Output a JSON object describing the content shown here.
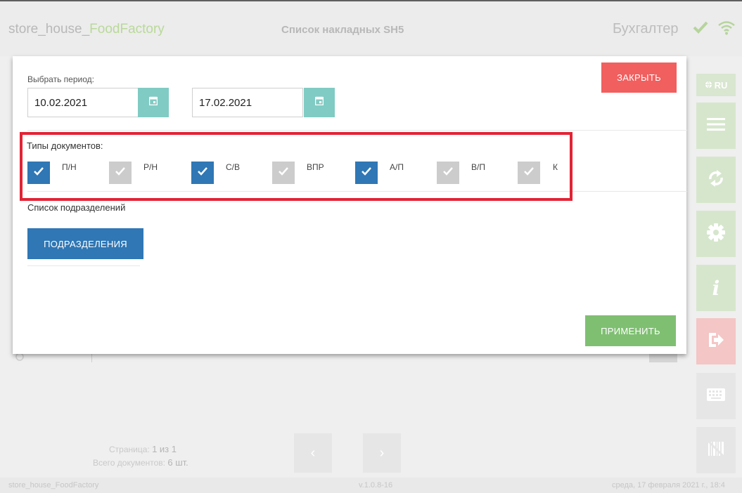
{
  "header": {
    "app_name_prefix": "store_house_",
    "app_name_accent": "FoodFactory",
    "page_title": "Список накладных SH5",
    "user_role": "Бухгалтер"
  },
  "sidebar": {
    "lang_label": "RU",
    "icons": [
      "globe-icon",
      "menu-icon",
      "sync-icon",
      "gear-icon",
      "info-icon",
      "exit-icon",
      "keyboard-icon",
      "barcode-icon"
    ],
    "info_glyph": "i"
  },
  "modal": {
    "period_label": "Выбрать период:",
    "date_from": "10.02.2021",
    "date_to": "17.02.2021",
    "close_label": "ЗАКРЫТЬ",
    "doc_types_label": "Типы документов:",
    "doc_types": [
      {
        "label": "П/Н",
        "checked": true
      },
      {
        "label": "Р/Н",
        "checked": false
      },
      {
        "label": "С/В",
        "checked": true
      },
      {
        "label": "ВПР",
        "checked": false
      },
      {
        "label": "А/П",
        "checked": true
      },
      {
        "label": "В/П",
        "checked": false
      },
      {
        "label": "К",
        "checked": false
      }
    ],
    "units_label": "Список подразделений",
    "units_button": "ПОДРАЗДЕЛЕНИЯ",
    "apply_label": "ПРИМЕНИТЬ"
  },
  "pager": {
    "page_prefix": "Страница:",
    "page_value": "1 из 1",
    "docs_prefix": "Всего документов:",
    "docs_value": "6 шт.",
    "prev_glyph": "‹",
    "next_glyph": "›"
  },
  "footer": {
    "left": "store_house_FoodFactory",
    "version": "v.1.0.8-16",
    "date": "среда, 17 февраля 2021 г., 18:4"
  },
  "colors": {
    "primary": "#2f77b5",
    "danger": "#f15f5f",
    "success": "#7fbf72",
    "calendar": "#80cbc4",
    "highlight": "#e22335"
  }
}
